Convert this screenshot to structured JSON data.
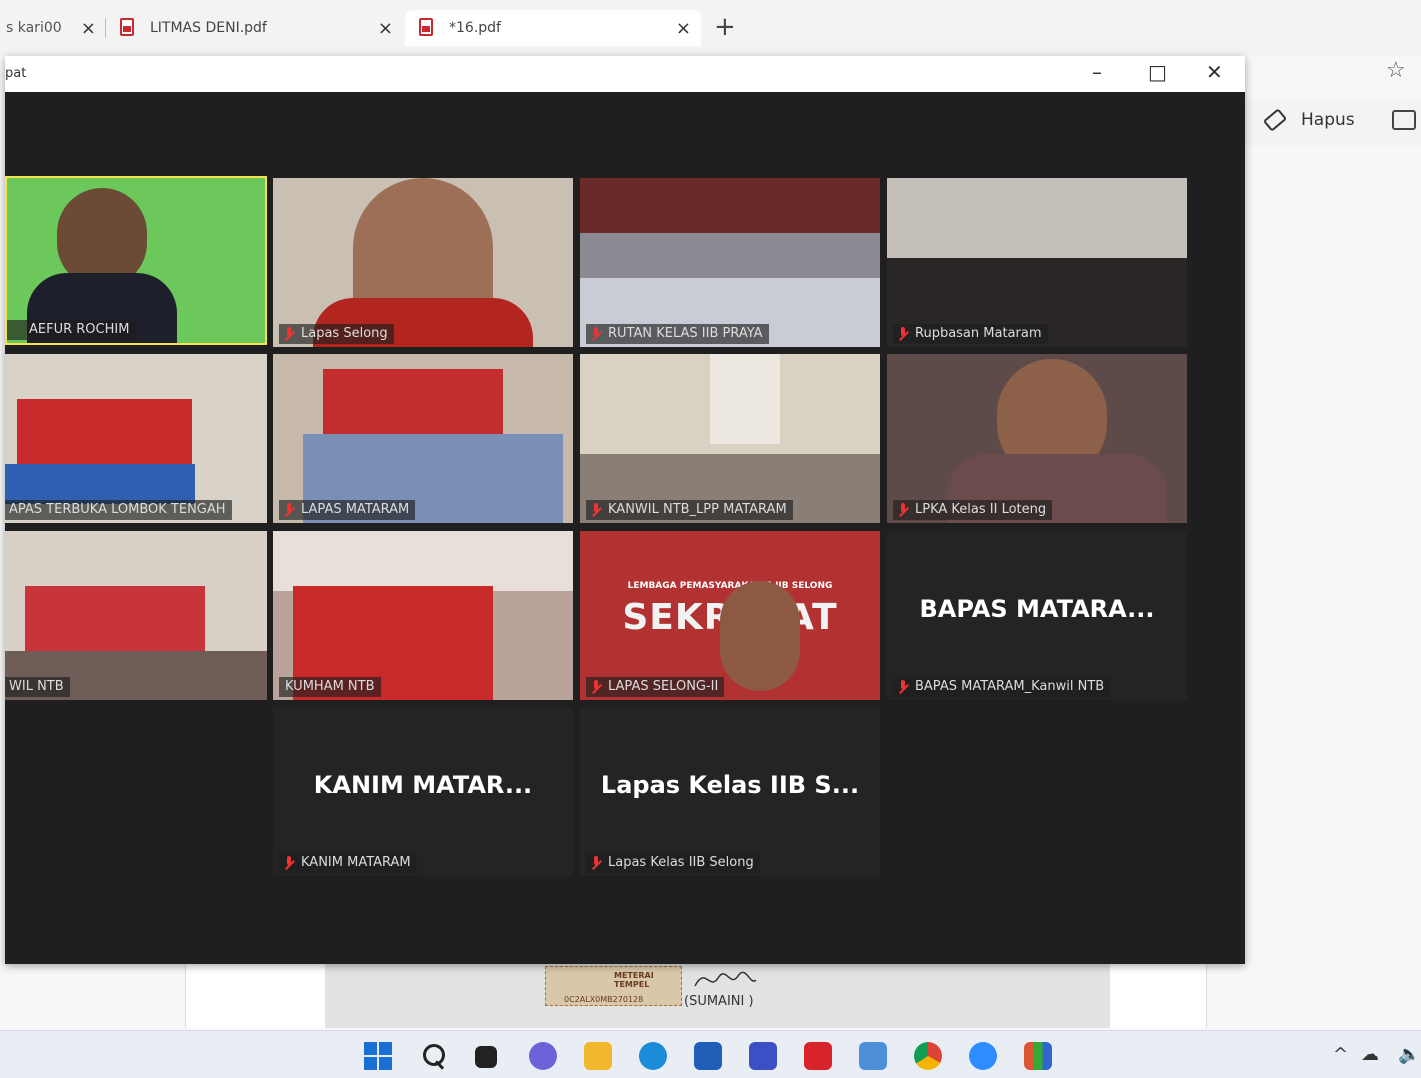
{
  "tabs": [
    {
      "label": "s kari00",
      "active": false
    },
    {
      "label": "LITMAS DENI.pdf",
      "active": false
    },
    {
      "label": "*16.pdf",
      "active": true
    }
  ],
  "icons": {
    "close": "×",
    "new_tab": "+",
    "minimize": "–",
    "maximize": "□",
    "window_close": "✕"
  },
  "zoom": {
    "title": "pat"
  },
  "pdf_toolbar": {
    "erase_label": "Hapus"
  },
  "participants": [
    {
      "label": "AEFUR ROCHIM",
      "bg": "#6cc85a",
      "active": true
    },
    {
      "label": "Lapas Selong",
      "bg": "#9c6f56"
    },
    {
      "label": "RUTAN KELAS IIB PRAYA",
      "bg": "#8b8a92"
    },
    {
      "label": "Rupbasan Mataram",
      "bg": "#6c5c56"
    },
    {
      "label": "APAS TERBUKA LOMBOK TENGAH",
      "bg": "#b55a5c"
    },
    {
      "label": "LAPAS MATARAM",
      "bg": "#9a7568"
    },
    {
      "label": "KANWIL NTB_LPP MATARAM",
      "bg": "#a79a88"
    },
    {
      "label": "LPKA Kelas II Loteng",
      "bg": "#5e4a48"
    },
    {
      "label": "WIL NTB",
      "bg": "#a46866"
    },
    {
      "label": "KUMHAM NTB",
      "bg": "#8a5e58"
    },
    {
      "label": "LAPAS SELONG-II",
      "bg": "#b23232",
      "banner_top": "LEMBAGA PEMASYARAKA   AS IIB SELONG",
      "banner_main": "SEKRE   IAT"
    },
    {
      "label": "BAPAS MATARAM_Kanwil NTB",
      "bg": "#242424",
      "name": "BAPAS  MATARA..."
    },
    {
      "label": "KANIM MATARAM",
      "bg": "#242424",
      "name": "KANIM  MATAR..."
    },
    {
      "label": "Lapas Kelas IIB Selong",
      "bg": "#242424",
      "name": "Lapas Kelas IIB S..."
    }
  ],
  "document": {
    "stamp_text": "METERAI TEMPEL",
    "stamp_code": "0C2ALX0MB270128",
    "signatory": "(SUMAINI )"
  },
  "colors": {
    "zoom_bg": "#1f1f1f",
    "active_speaker": "#f4e24a",
    "mic_muted": "#e33333"
  }
}
